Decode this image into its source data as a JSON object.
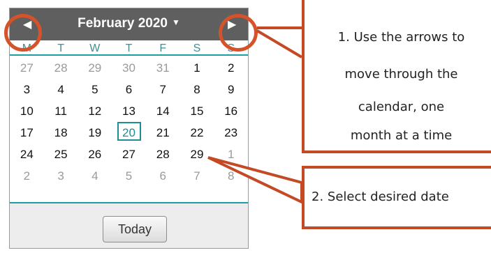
{
  "calendar": {
    "month_title": "February 2020",
    "caret": "▼",
    "prev_icon": "◀",
    "next_icon": "▶",
    "weekdays": [
      "M",
      "T",
      "W",
      "T",
      "F",
      "S",
      "S"
    ],
    "weeks": [
      [
        "27",
        "28",
        "29",
        "30",
        "31",
        "1",
        "2"
      ],
      [
        "3",
        "4",
        "5",
        "6",
        "7",
        "8",
        "9"
      ],
      [
        "10",
        "11",
        "12",
        "13",
        "14",
        "15",
        "16"
      ],
      [
        "17",
        "18",
        "19",
        "20",
        "21",
        "22",
        "23"
      ],
      [
        "24",
        "25",
        "26",
        "27",
        "28",
        "29",
        "1"
      ],
      [
        "2",
        "3",
        "4",
        "5",
        "6",
        "7",
        "8"
      ]
    ],
    "selected_day": "20",
    "today_label": "Today"
  },
  "annotations": {
    "box1_lines": [
      "1. Use the arrows to",
      "move through the",
      "calendar, one",
      "month at a time"
    ],
    "box2_text": "2. Select desired date"
  },
  "colors": {
    "header_bg": "#5f5f5f",
    "accent_teal": "#1b8f93",
    "annotation_orange": "#c44a25"
  }
}
